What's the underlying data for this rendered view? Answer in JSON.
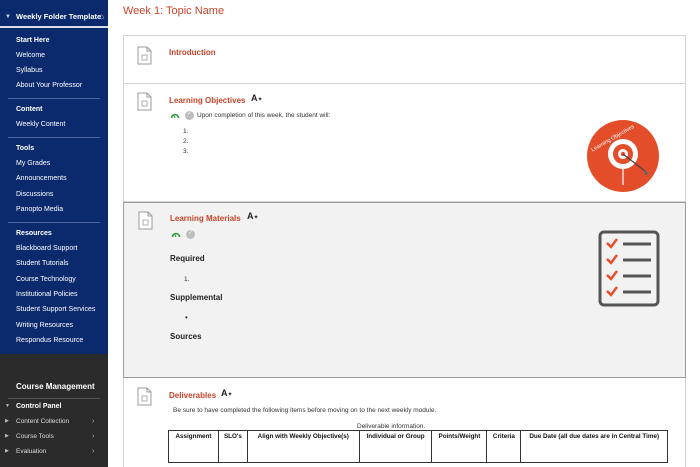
{
  "sidebar": {
    "course_title": "Weekly Folder Template",
    "sections": [
      {
        "heading": "Start Here",
        "items": [
          "Welcome",
          "Syllabus",
          "About Your Professor"
        ]
      },
      {
        "heading": "Content",
        "items": [
          "Weekly Content"
        ]
      },
      {
        "heading": "Tools",
        "items": [
          "My Grades",
          "Announcements",
          "Discussions",
          "Panopto Media"
        ]
      },
      {
        "heading": "Resources",
        "items": [
          "Blackboard Support",
          "Student Tutorials",
          "Course Technology",
          "Institutional Policies",
          "Student Support Services",
          "Writing Resources",
          "Respondus Resource"
        ]
      }
    ]
  },
  "management": {
    "title": "Course Management",
    "control_panel": "Control Panel",
    "rows": [
      "Content Collection",
      "Course Tools",
      "Evaluation"
    ]
  },
  "page": {
    "title": "Week 1: Topic Name"
  },
  "items": {
    "introduction": {
      "title": "Introduction"
    },
    "objectives": {
      "title": "Learning Objectives",
      "intro_text": "Upon completion of this week, the student will:",
      "list": [
        "1.",
        "2.",
        "3."
      ],
      "graphic_text": "Learning Objectives"
    },
    "materials": {
      "title": "Learning Materials",
      "required": "Required",
      "required_list": [
        "1."
      ],
      "supplemental": "Supplemental",
      "supplemental_bullet": "•",
      "sources": "Sources"
    },
    "deliverables": {
      "title": "Deliverables",
      "intro_text": "Be sure to have completed the following items before moving on to the next weekly module.",
      "caption": "Deliverable information.",
      "columns": [
        "Assignment",
        "SLO's",
        "Align with Weekly Objective(s)",
        "Individual or Group",
        "Points/Weight",
        "Criteria",
        "Due Date (all due dates are in Central Time)"
      ]
    }
  },
  "colors": {
    "accent": "#c8432a",
    "nav_blue": "#0b2a6e",
    "nav_dark": "#2b2b2b"
  }
}
